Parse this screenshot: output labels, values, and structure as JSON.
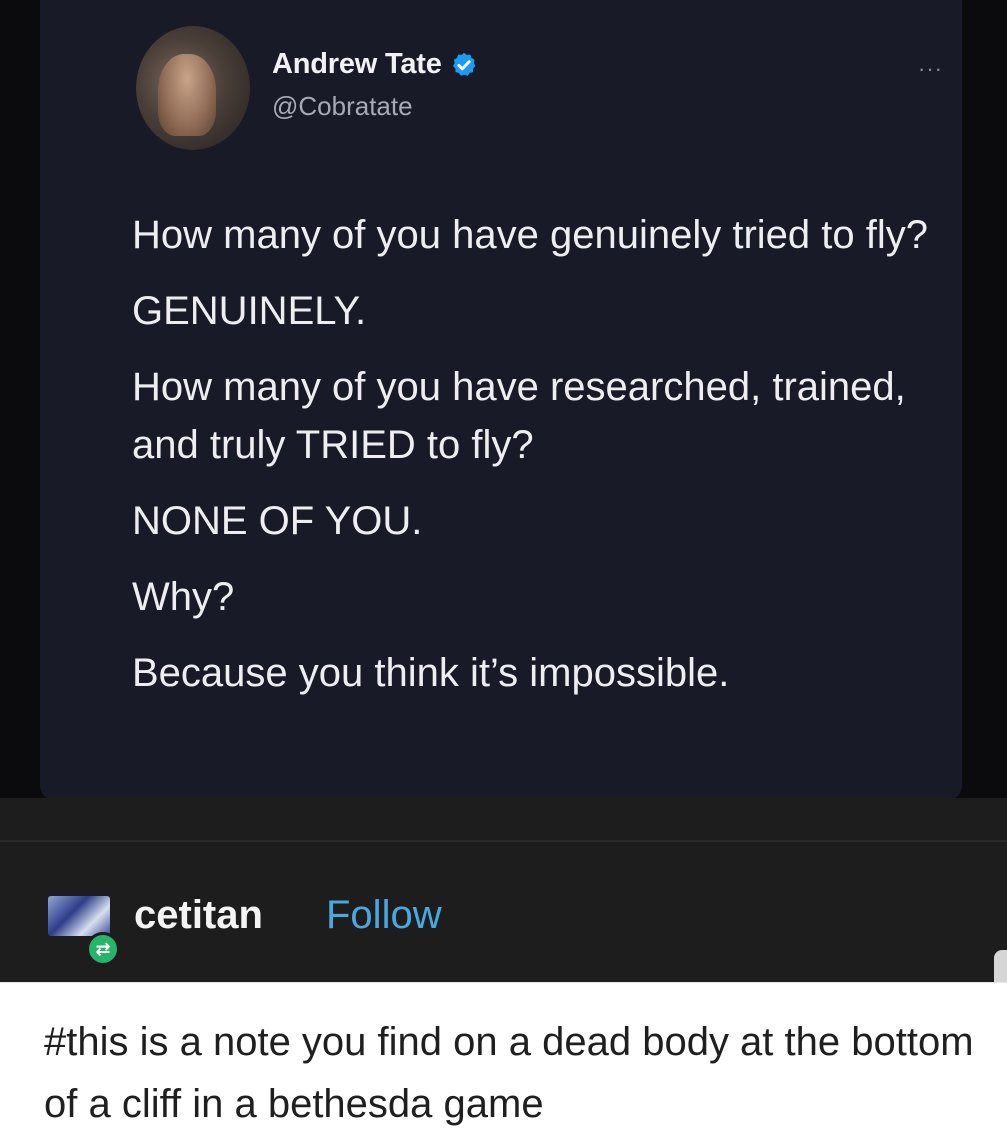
{
  "tweet": {
    "author_name": "Andrew Tate",
    "author_handle": "@Cobratate",
    "more_label": "···",
    "paragraphs": [
      "How many of you have genuinely tried to fly?",
      "GENUINELY.",
      "How many of you have researched, trained, and truly TRIED to fly?",
      "NONE OF YOU.",
      "Why?",
      "Because you think it’s impossible."
    ]
  },
  "reblog": {
    "username": "cetitan",
    "follow_label": "Follow",
    "reblog_icon": "reblog-icon",
    "reblog_glyph": "⇄"
  },
  "post": {
    "text": "#this is a note you find on a dead body at the bottom of a cliff in a bethesda game"
  },
  "colors": {
    "tweet_bg": "#181a27",
    "verified": "#1d9bf0",
    "follow": "#4aa8e0",
    "reblog_green": "#26b36a"
  }
}
